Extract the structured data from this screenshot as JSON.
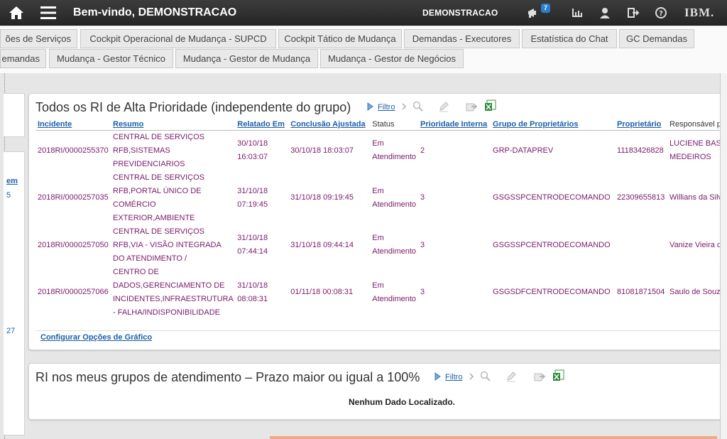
{
  "header": {
    "welcome": "Bem-vindo, DEMONSTRACAO",
    "user": "DEMONSTRACAO",
    "notification_count": "7",
    "brand": "IBM."
  },
  "tabs_row1": [
    "ões de Serviços",
    "Cockpit Operacional de Mudança - SUPCD",
    "Cockpit Tático de Mudança",
    "Demandas - Executores",
    "Estatística do Chat",
    "GC Demandas"
  ],
  "tabs_row2": [
    "emandas",
    "Mudança - Gestor Técnico",
    "Mudança - Gestor de Mudança",
    "Mudança - Gestor de Negócios"
  ],
  "left_links": [
    "em",
    "5",
    "27"
  ],
  "panel1": {
    "title": "Todos os RI de Alta Prioridade (independente do grupo)",
    "filter_label": "Filtro",
    "columns": [
      "Incidente",
      "Resumo",
      "Relatado Em",
      "Conclusão Ajustada",
      "Status",
      "Prioridade Interna",
      "Grupo de Proprietários",
      "Proprietário",
      "Responsável p"
    ],
    "rows": [
      {
        "incidente": "2018RI/0000255370",
        "resumo": "CENTRAL DE SERVIÇOS RFB,SISTEMAS PREVIDENCIARIOS",
        "relatado": "30/10/18 16:03:07",
        "conclusao": "30/10/18 18:03:07",
        "status": "Em Atendimento",
        "prioridade": "2",
        "grupo": "GRP-DATAPREV",
        "proprietario": "11183426828",
        "responsavel": "LUCIENE BAS MEDEIROS"
      },
      {
        "incidente": "2018RI/0000257035",
        "resumo": "CENTRAL DE SERVIÇOS RFB,PORTAL ÚNICO DE COMÉRCIO EXTERIOR,AMBIENTE",
        "relatado": "31/10/18 07:19:45",
        "conclusao": "31/10/18 09:19:45",
        "status": "Em Atendimento",
        "prioridade": "3",
        "grupo": "GSGSSPCENTRODECOMANDO",
        "proprietario": "22309655813",
        "responsavel": "Willians da Silv"
      },
      {
        "incidente": "2018RI/0000257050",
        "resumo": "CENTRAL DE SERVIÇOS RFB,VIA - VISÃO INTEGRADA DO ATENDIMENTO /",
        "relatado": "31/10/18 07:44:14",
        "conclusao": "31/10/18 09:44:14",
        "status": "Em Atendimento",
        "prioridade": "3",
        "grupo": "GSGSSPCENTRODECOMANDO",
        "proprietario": "",
        "responsavel": "Vanize Vieira d"
      },
      {
        "incidente": "2018RI/0000257066",
        "resumo": "CENTRO DE DADOS,GERENCIAMENTO DE INCIDENTES,INFRAESTRUTURA - FALHA/INDISPONIBILIDADE",
        "relatado": "31/10/18 08:08:31",
        "conclusao": "01/11/18 00:08:31",
        "status": "Em Atendimento",
        "prioridade": "3",
        "grupo": "GSGSDFCENTRODECOMANDO",
        "proprietario": "81081871504",
        "responsavel": "Saulo de Souz"
      }
    ],
    "config_link": "Configurar Opções de Gráfico"
  },
  "panel2": {
    "title": "RI nos meus grupos de atendimento – Prazo maior ou igual a 100%",
    "filter_label": "Filtro",
    "no_data": "Nenhum Dado Localizado."
  }
}
